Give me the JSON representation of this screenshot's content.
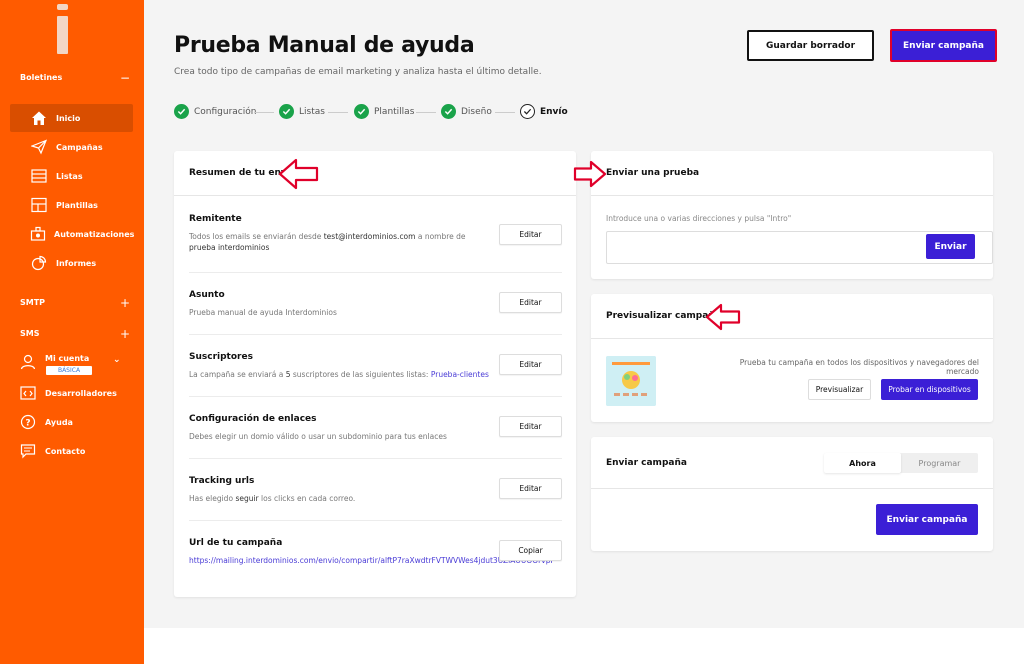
{
  "sidebar": {
    "section_boletines": "Boletines",
    "items": [
      {
        "label": "Inicio",
        "icon": "home-icon"
      },
      {
        "label": "Campañas",
        "icon": "paper-plane-icon"
      },
      {
        "label": "Listas",
        "icon": "list-icon"
      },
      {
        "label": "Plantillas",
        "icon": "template-icon"
      },
      {
        "label": "Automatizaciones",
        "icon": "automation-icon"
      },
      {
        "label": "Informes",
        "icon": "report-icon"
      }
    ],
    "section_smtp": "SMTP",
    "section_sms": "SMS",
    "account_label": "Mi cuenta",
    "account_badge": "BÁSICA",
    "developers": "Desarrolladores",
    "help": "Ayuda",
    "contact": "Contacto"
  },
  "header": {
    "title": "Prueba Manual de ayuda",
    "subtitle": "Crea todo tipo de campañas de email marketing y analiza hasta el último detalle.",
    "draft_button": "Guardar borrador",
    "send_button": "Enviar campaña"
  },
  "steps": [
    {
      "label": "Configuración",
      "done": true
    },
    {
      "label": "Listas",
      "done": true
    },
    {
      "label": "Plantillas",
      "done": true
    },
    {
      "label": "Diseño",
      "done": true
    },
    {
      "label": "Envío",
      "done": false
    }
  ],
  "summary": {
    "title": "Resumen de tu envío",
    "remitente": {
      "title": "Remitente",
      "pre": "Todos los emails se enviarán desde",
      "email": "test@interdominios.com",
      "mid": "a nombre de",
      "name": "prueba interdominios",
      "button": "Editar"
    },
    "asunto": {
      "title": "Asunto",
      "desc": "Prueba manual de ayuda Interdominios",
      "button": "Editar"
    },
    "suscriptores": {
      "title": "Suscriptores",
      "pre": "La campaña se enviará a",
      "count": "5",
      "mid": "suscriptores de las siguientes listas:",
      "list": "Prueba-clientes",
      "button": "Editar"
    },
    "enlaces": {
      "title": "Configuración de enlaces",
      "desc": "Debes elegir un domio válido o usar un subdominio para tus enlaces",
      "button": "Editar"
    },
    "tracking": {
      "title": "Tracking urls",
      "pre": "Has elegido",
      "strong": "seguir",
      "post": "los clicks en cada correo.",
      "button": "Editar"
    },
    "url": {
      "title": "Url de tu campaña",
      "link": "https://mailing.interdominios.com/envio/compartir/alftP7raXwdtrFVTWVWes4jdut3UZlAUUOOrvpF",
      "button": "Copiar"
    }
  },
  "test": {
    "title": "Enviar una prueba",
    "label": "Introduce una o varias direcciones y pulsa \"Intro\"",
    "input_value": "",
    "button": "Enviar"
  },
  "preview": {
    "title": "Previsualizar campaña",
    "text": "Prueba tu campaña en todos los dispositivos y navegadores del mercado",
    "preview_button": "Previsualizar",
    "devices_button": "Probar en dispositivos"
  },
  "send": {
    "title": "Enviar campaña",
    "now": "Ahora",
    "schedule": "Programar",
    "button": "Enviar campaña"
  },
  "colors": {
    "brand": "#ff5b00",
    "primary": "#3b1fd6",
    "success": "#1aa34a",
    "annotation": "#e0002a"
  }
}
